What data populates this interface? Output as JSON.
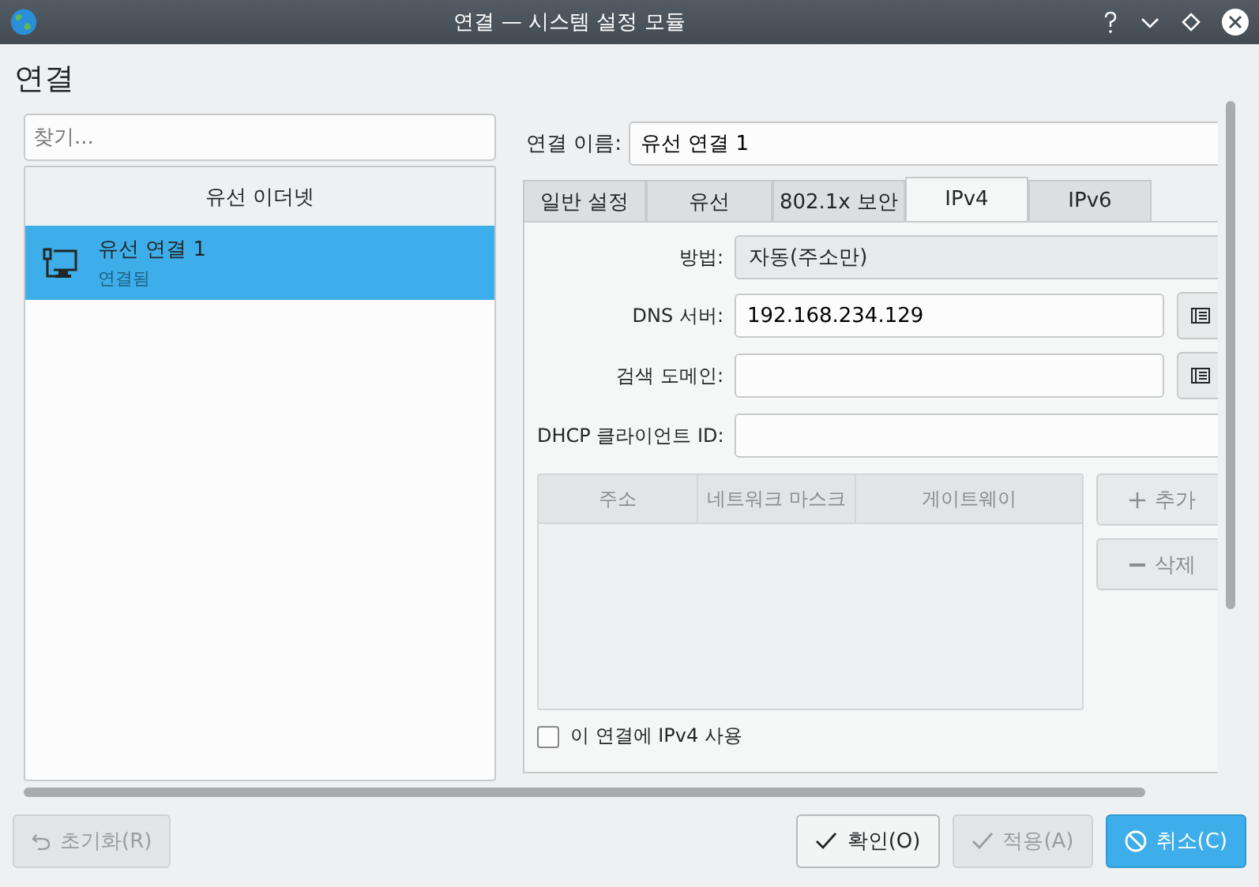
{
  "window": {
    "title": "연결 — 시스템 설정 모듈"
  },
  "page_title": "연결",
  "search": {
    "placeholder": "찾기..."
  },
  "connections": {
    "header": "유선 이더넷",
    "items": [
      {
        "name": "유선 연결 1",
        "status": "연결됨",
        "selected": true
      }
    ]
  },
  "connection_name": {
    "label": "연결 이름:",
    "value": "유선 연결 1"
  },
  "tabs": [
    {
      "label": "일반 설정",
      "selected": false
    },
    {
      "label": "유선",
      "selected": false
    },
    {
      "label": "802.1x 보안",
      "selected": false
    },
    {
      "label": "IPv4",
      "selected": true
    },
    {
      "label": "IPv6",
      "selected": false
    }
  ],
  "method": {
    "label": "방법:",
    "value": "자동(주소만)"
  },
  "dns_server": {
    "label": "DNS 서버:",
    "value": "192.168.234.129"
  },
  "search_domains": {
    "label": "검색 도메인:"
  },
  "dhcp_client_id": {
    "label": "DHCP 클라이언트 ID:"
  },
  "addresses": {
    "columns": [
      "주소",
      "네트워크 마스크",
      "게이트웨이"
    ],
    "disabled": true,
    "buttons": [
      {
        "label": "추가",
        "kind": "add",
        "disabled": true
      },
      {
        "label": "삭제",
        "kind": "remove",
        "disabled": true
      }
    ]
  },
  "require_ipv4": {
    "label": "이 연결에 IPv4 사용",
    "checked": false
  },
  "footer_buttons": [
    {
      "label": "초기화(R)",
      "kind": "reset",
      "disabled": true,
      "highlighted": false
    },
    {
      "label": "확인(O)",
      "kind": "ok",
      "disabled": false,
      "highlighted": false
    },
    {
      "label": "적용(A)",
      "kind": "apply",
      "disabled": true,
      "highlighted": false
    },
    {
      "label": "취소(C)",
      "kind": "cancel",
      "disabled": false,
      "highlighted": true
    }
  ]
}
